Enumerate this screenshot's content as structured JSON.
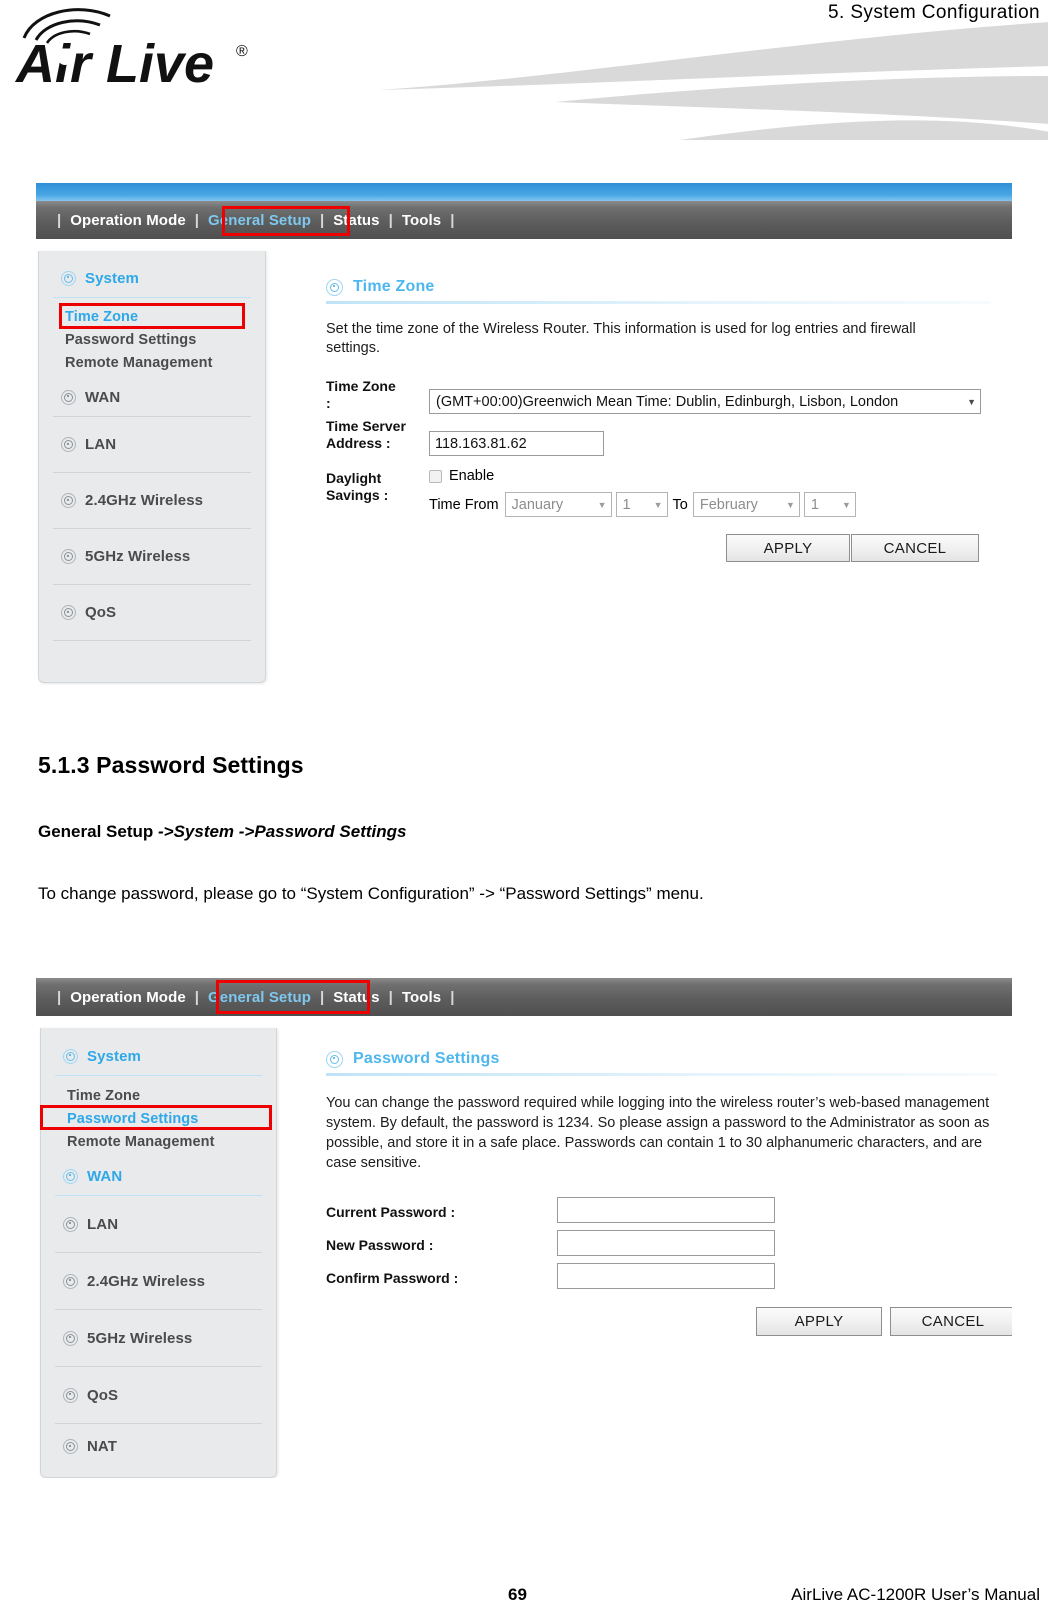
{
  "page": {
    "chapter_header": "5.  System  Configuration",
    "brand": "Air Live",
    "footer_page_number": "69",
    "footer_manual": "AirLive AC-1200R User’s Manual"
  },
  "doc": {
    "section_heading": "5.1.3 Password Settings",
    "breadcrumb_plain": "General Setup ",
    "breadcrumb_italic": "->System ->Password Settings",
    "paragraph": "To change password, please go to “System Configuration” -> “Password Settings” menu."
  },
  "nav": {
    "items": [
      {
        "label": "Operation Mode",
        "active": false
      },
      {
        "label": "General Setup",
        "active": true
      },
      {
        "label": "Status",
        "active": false
      },
      {
        "label": "Tools",
        "active": false
      }
    ],
    "separator": "|"
  },
  "colors": {
    "accent_blue": "#2fa8e8",
    "highlight_red": "#ef0000",
    "navbar_gray": "#5d5d5d",
    "sidebar_gray": "#e8eaec",
    "title_blue": "#4db7ee"
  },
  "screenshot_one": {
    "sidebar": {
      "groups": [
        {
          "label": "System",
          "icon": "target-icon",
          "blue": true
        },
        {
          "label": "WAN",
          "icon": "target-icon",
          "blue": false
        },
        {
          "label": "LAN",
          "icon": "target-icon",
          "blue": false
        },
        {
          "label": "2.4GHz Wireless",
          "icon": "target-icon",
          "blue": false
        },
        {
          "label": "5GHz Wireless",
          "icon": "target-icon",
          "blue": false
        },
        {
          "label": "QoS",
          "icon": "target-icon",
          "blue": false
        }
      ],
      "system_sub_items": [
        {
          "label": "Time Zone",
          "selected": true
        },
        {
          "label": "Password Settings",
          "selected": false
        },
        {
          "label": "Remote Management",
          "selected": false
        }
      ]
    },
    "content": {
      "title": "Time Zone",
      "title_icon": "target-icon",
      "description": "Set the time zone of the Wireless Router. This information is used for log entries and firewall settings.",
      "fields": {
        "time_zone_label": "Time Zone :",
        "time_zone_value": "(GMT+00:00)Greenwich Mean Time: Dublin, Edinburgh, Lisbon, London",
        "time_server_label": "Time Server Address :",
        "time_server_value": "118.163.81.62",
        "daylight_label": "Daylight Savings :",
        "enable_label": "Enable",
        "enable_checked": false,
        "time_from_label": "Time From",
        "from_month": "January",
        "from_day": "1",
        "to_label": "To",
        "to_month": "February",
        "to_day": "1"
      },
      "buttons": {
        "apply": "APPLY",
        "cancel": "CANCEL"
      }
    }
  },
  "screenshot_two": {
    "sidebar": {
      "groups": [
        {
          "label": "System",
          "icon": "target-icon",
          "blue": true
        },
        {
          "label": "WAN",
          "icon": "target-icon",
          "blue": true
        },
        {
          "label": "LAN",
          "icon": "target-icon",
          "blue": false
        },
        {
          "label": "2.4GHz Wireless",
          "icon": "target-icon",
          "blue": false
        },
        {
          "label": "5GHz Wireless",
          "icon": "target-icon",
          "blue": false
        },
        {
          "label": "QoS",
          "icon": "target-icon",
          "blue": false
        },
        {
          "label": "NAT",
          "icon": "target-icon",
          "blue": false
        }
      ],
      "system_sub_items": [
        {
          "label": "Time Zone",
          "selected": false
        },
        {
          "label": "Password Settings",
          "selected": true
        },
        {
          "label": "Remote Management",
          "selected": false
        }
      ]
    },
    "content": {
      "title": "Password Settings",
      "title_icon": "target-icon",
      "description": "You can change the password required while logging into the wireless router’s web-based management system. By default, the password is 1234. So please assign a password to the Administrator as soon as possible, and store it in a safe place. Passwords can contain 1 to 30 alphanumeric characters, and are case sensitive.",
      "fields": [
        {
          "label": "Current Password :",
          "value": ""
        },
        {
          "label": "New Password :",
          "value": ""
        },
        {
          "label": "Confirm Password :",
          "value": ""
        }
      ],
      "buttons": {
        "apply": "APPLY",
        "cancel": "CANCEL"
      }
    }
  }
}
